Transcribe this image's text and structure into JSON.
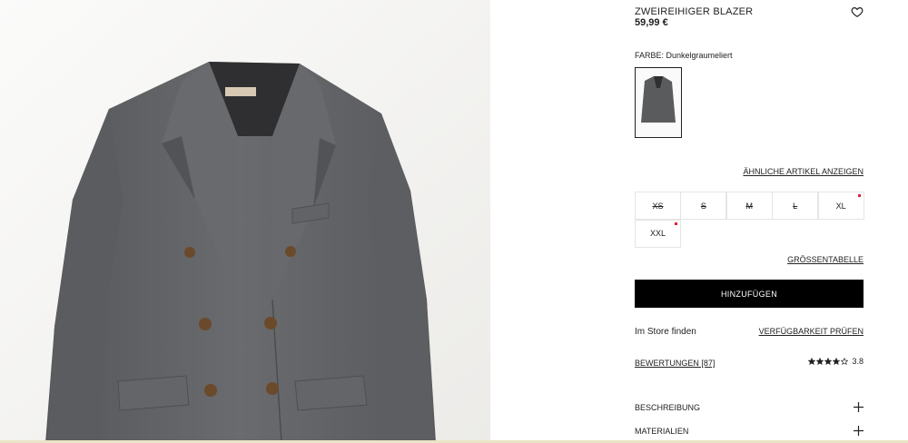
{
  "product": {
    "title": "ZWEIREIHIGER BLAZER",
    "price": "59,99 €",
    "favorite_icon": "heart-icon"
  },
  "color": {
    "label": "FARBE: Dunkelgraumeliert",
    "swatch_color": "#5a5b5d"
  },
  "similar_link": "ÄHNLICHE ARTIKEL ANZEIGEN",
  "sizes": [
    {
      "label": "XS",
      "available": false,
      "low_stock": false
    },
    {
      "label": "S",
      "available": false,
      "low_stock": false
    },
    {
      "label": "M",
      "available": false,
      "low_stock": false
    },
    {
      "label": "L",
      "available": false,
      "low_stock": false
    },
    {
      "label": "XL",
      "available": true,
      "low_stock": true
    },
    {
      "label": "XXL",
      "available": true,
      "low_stock": true
    }
  ],
  "size_chart_link": "GRÖSSENTABELLE",
  "add_button": "HINZUFÜGEN",
  "store": {
    "label": "Im Store finden",
    "availability_link": "VERFÜGBARKEIT PRÜFEN"
  },
  "reviews": {
    "link": "BEWERTUNGEN [87]",
    "rating": "3.8",
    "rating_value": 3.8,
    "max_stars": 5
  },
  "accordions": [
    {
      "label": "BESCHREIBUNG",
      "icon": "plus-icon"
    },
    {
      "label": "MATERIALIEN",
      "icon": "plus-icon"
    }
  ],
  "colors": {
    "accent": "#000000",
    "low_stock_dot": "#e0203a",
    "blazer": "#5f6062"
  }
}
